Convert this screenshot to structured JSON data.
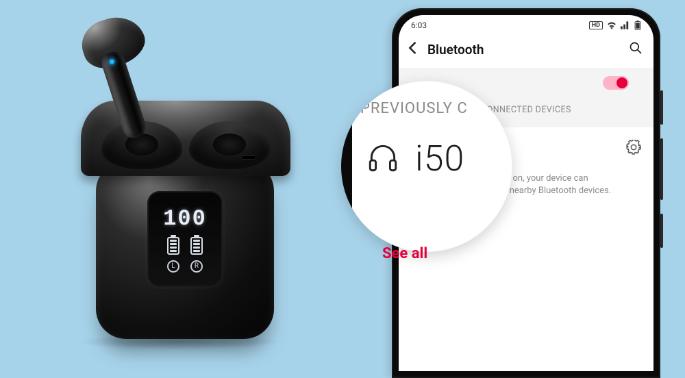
{
  "earbuds_case": {
    "battery_percent": "100",
    "left_label": "L",
    "right_label": "R"
  },
  "phone": {
    "statusbar": {
      "time": "6:03",
      "hd_label": "HD"
    },
    "header": {
      "title": "Bluetooth"
    },
    "sections": {
      "toggle_on": true,
      "previously_label_full": "PREVIOUSLY CONNECTED DEVICES",
      "connected_devices_label": "CONNECTED DEVICES"
    },
    "device": {
      "name": "i50"
    },
    "hint_text": "When Bluetooth is turned on, your device can communicate with other nearby Bluetooth devices.",
    "see_all_label": "See all"
  },
  "magnifier": {
    "header_partial": "PREVIOUSLY  C",
    "device_name": "i50"
  }
}
